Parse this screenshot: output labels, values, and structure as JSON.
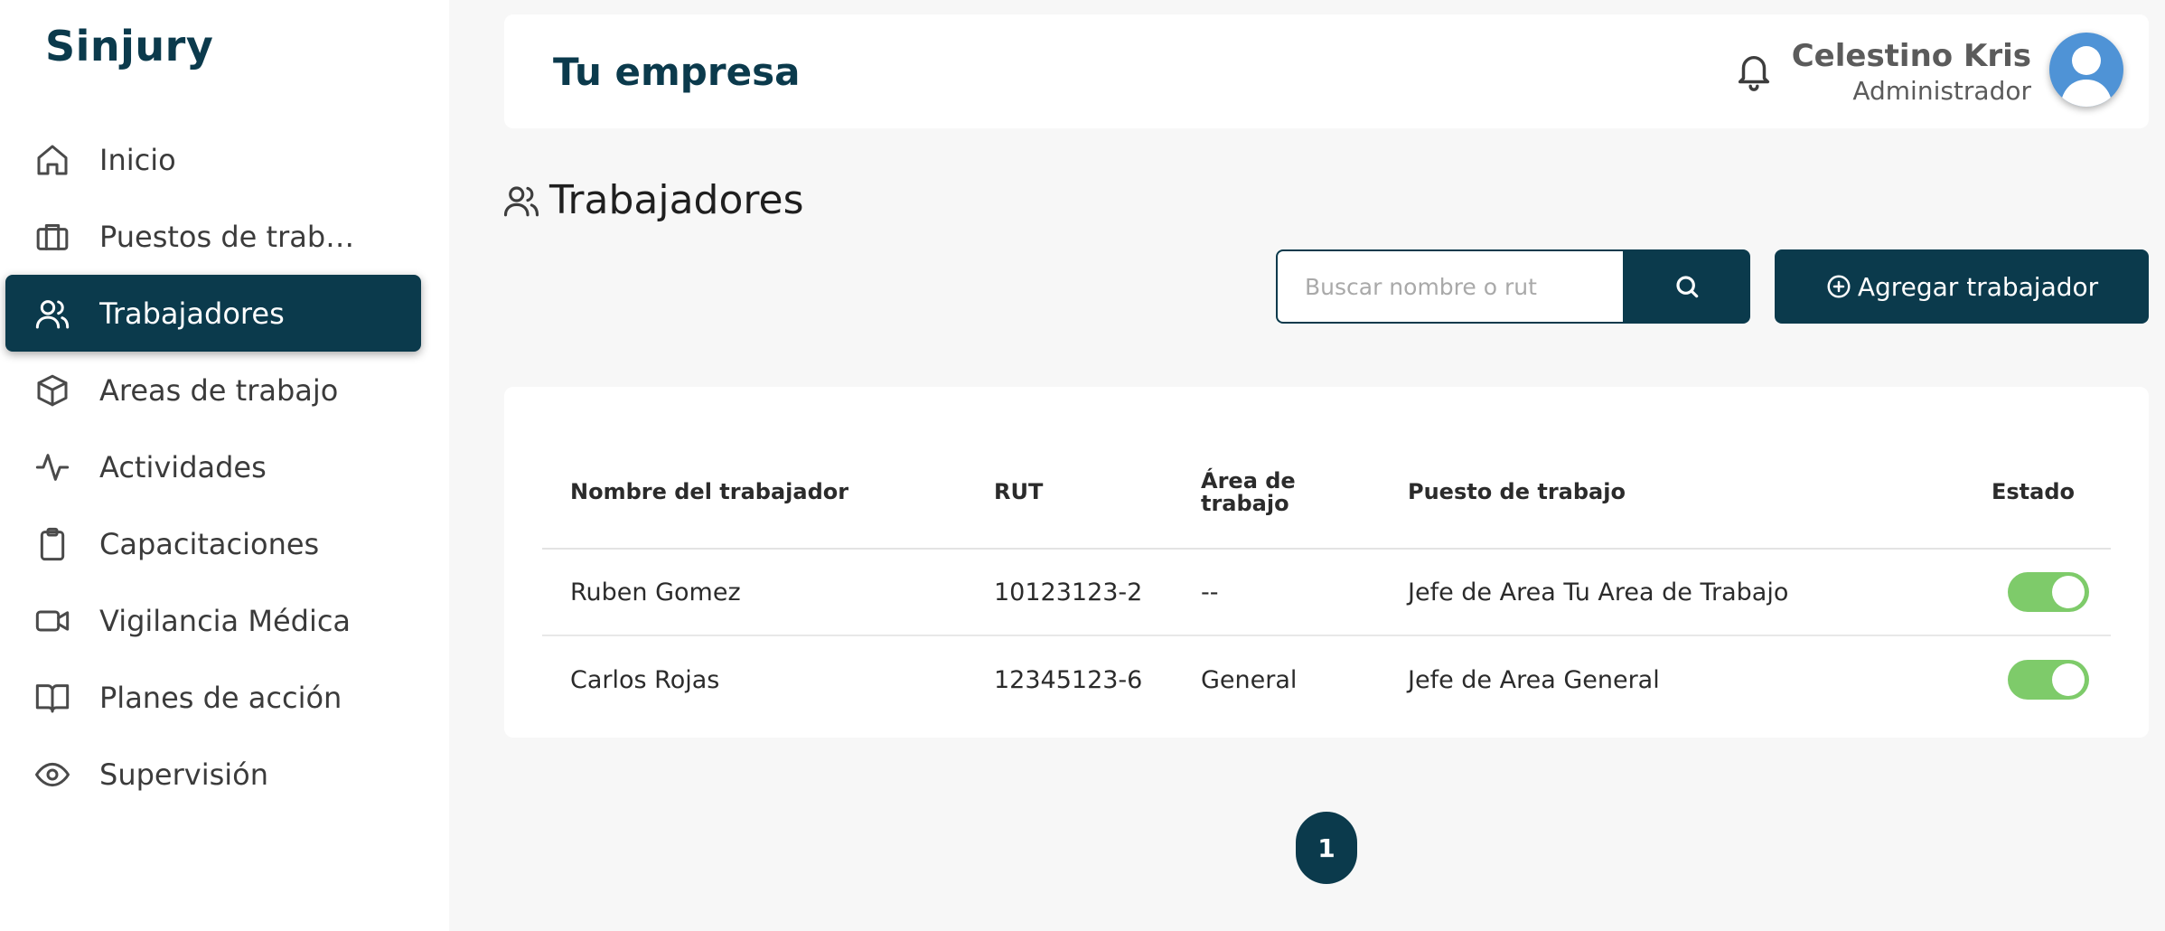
{
  "brand": "Sinjury",
  "sidebar": {
    "items": [
      {
        "label": "Inicio",
        "icon": "home-icon",
        "active": false
      },
      {
        "label": "Puestos de traba...",
        "icon": "briefcase-icon",
        "active": false
      },
      {
        "label": "Trabajadores",
        "icon": "users-icon",
        "active": true
      },
      {
        "label": "Areas de trabajo",
        "icon": "box-icon",
        "active": false
      },
      {
        "label": "Actividades",
        "icon": "activity-icon",
        "active": false
      },
      {
        "label": "Capacitaciones",
        "icon": "clipboard-icon",
        "active": false
      },
      {
        "label": "Vigilancia Médica",
        "icon": "video-icon",
        "active": false
      },
      {
        "label": "Planes de acción",
        "icon": "book-icon",
        "active": false
      },
      {
        "label": "Supervisión",
        "icon": "eye-icon",
        "active": false
      }
    ]
  },
  "header": {
    "title": "Tu empresa",
    "user_name": "Celestino Kris",
    "user_role": "Administrador"
  },
  "section": {
    "title": "Trabajadores"
  },
  "search": {
    "placeholder": "Buscar nombre o rut",
    "value": ""
  },
  "actions": {
    "add_label": "Agregar trabajador"
  },
  "table": {
    "headers": [
      "Nombre del trabajador",
      "RUT",
      "Área de trabajo",
      "Puesto de trabajo",
      "Estado"
    ],
    "rows": [
      {
        "name": "Ruben Gomez",
        "rut": "10123123-2",
        "area": "--",
        "puesto": "Jefe de Area Tu Area de Trabajo",
        "estado": true
      },
      {
        "name": "Carlos Rojas",
        "rut": "12345123-6",
        "area": "General",
        "puesto": "Jefe de Area General",
        "estado": true
      }
    ]
  },
  "pagination": {
    "current": "1"
  },
  "colors": {
    "primary": "#0b3a4c",
    "toggle_on": "#7ecb6a",
    "avatar": "#4f93d6"
  }
}
